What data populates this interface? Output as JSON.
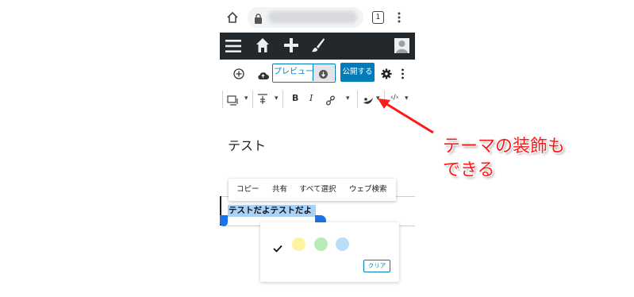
{
  "browser": {
    "tab_count": "1"
  },
  "editor": {
    "preview_label": "プレビュー",
    "publish_label": "公開する",
    "title": "テスト"
  },
  "context_menu": {
    "items": [
      "コピー",
      "共有",
      "すべて選択",
      "ウェブ検索"
    ]
  },
  "selected_text": "テストだよテストだよ",
  "color_popover": {
    "swatches": [
      "#fdf3a0",
      "#b6edb6",
      "#b8dff6"
    ],
    "clear_label": "クリア"
  },
  "annotation": {
    "line1": "テーマの装飾も",
    "line2": "できる",
    "color": "#ff1a1a"
  }
}
